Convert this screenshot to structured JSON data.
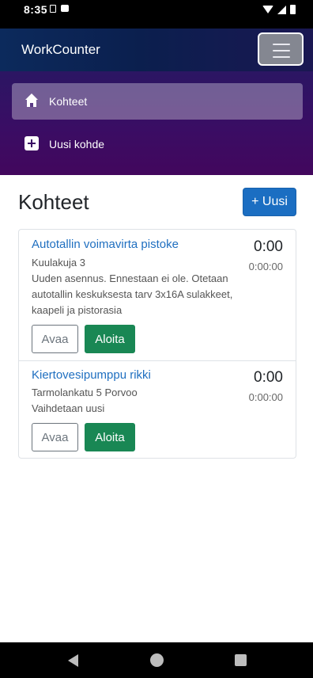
{
  "status_bar": {
    "time": "8:35"
  },
  "header": {
    "title": "WorkCounter"
  },
  "sidebar": {
    "items": [
      {
        "label": "Kohteet",
        "icon": "home-icon",
        "active": true
      },
      {
        "label": "Uusi kohde",
        "icon": "plus-square-icon",
        "active": false
      }
    ]
  },
  "main": {
    "title": "Kohteet",
    "new_button": "+ Uusi",
    "jobs": [
      {
        "title": "Autotallin voimavirta pistoke",
        "address": "Kuulakuja 3",
        "description": "Uuden asennus. Ennestaan ei ole. Otetaan autotallin keskuksesta tarv 3x16A sulakkeet, kaapeli ja pistorasia",
        "time": "0:00",
        "total": "0:00:00",
        "open_label": "Avaa",
        "start_label": "Aloita"
      },
      {
        "title": "Kiertovesipumppu rikki",
        "address": "Tarmolankatu 5 Porvoo",
        "description": "Vaihdetaan uusi",
        "time": "0:00",
        "total": "0:00:00",
        "open_label": "Avaa",
        "start_label": "Aloita"
      }
    ]
  },
  "colors": {
    "primary": "#1b6ec2",
    "success": "#198754",
    "link": "#1f6fc0",
    "header_bg": "#0b1f4e",
    "sidebar_bg": "#3a0d64"
  }
}
